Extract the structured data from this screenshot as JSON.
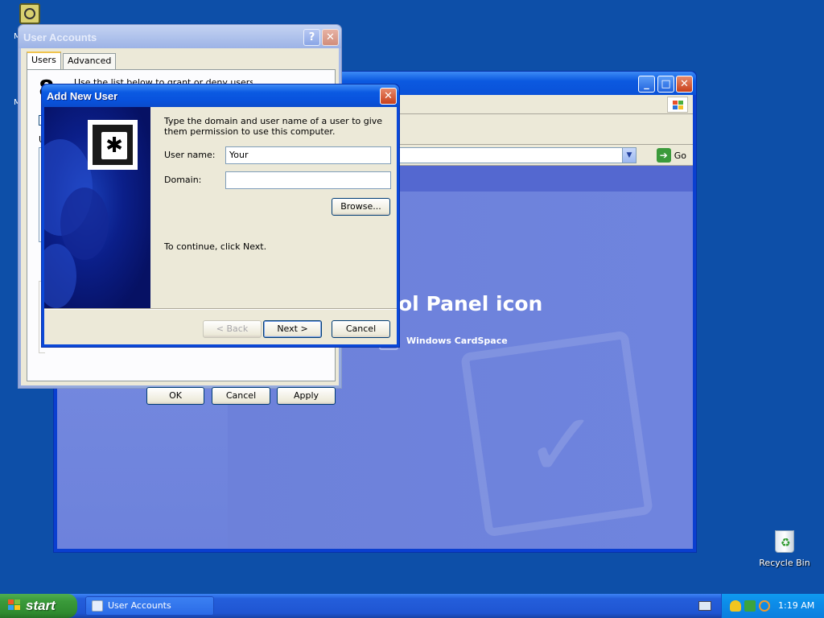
{
  "desktop": {
    "recycle_bin_label": "Recycle Bin",
    "partial_label_1": "M",
    "partial_label_2": "M"
  },
  "control_panel": {
    "go_label": "Go",
    "heading_partial": "ol Panel icon",
    "item_label": "Windows CardSpace"
  },
  "user_accounts": {
    "title": "User Accounts",
    "tabs": [
      "Users",
      "Advanced"
    ],
    "ok_label": "OK",
    "cancel_label": "Cancel",
    "apply_label": "Apply",
    "partial_text": "Use the list below to grant or deny users"
  },
  "add_new_user": {
    "title": "Add New User",
    "instructions": "Type the domain and user name of a user to give them permission to use this computer.",
    "username_label": "User name:",
    "username_value": "Your",
    "domain_label": "Domain:",
    "domain_value": "",
    "browse_label": "Browse...",
    "continue_text": "To continue, click Next.",
    "back_label": "< Back",
    "next_label": "Next >",
    "cancel_label": "Cancel"
  },
  "taskbar": {
    "start_label": "start",
    "task_label": "User Accounts",
    "clock": "1:19 AM"
  }
}
